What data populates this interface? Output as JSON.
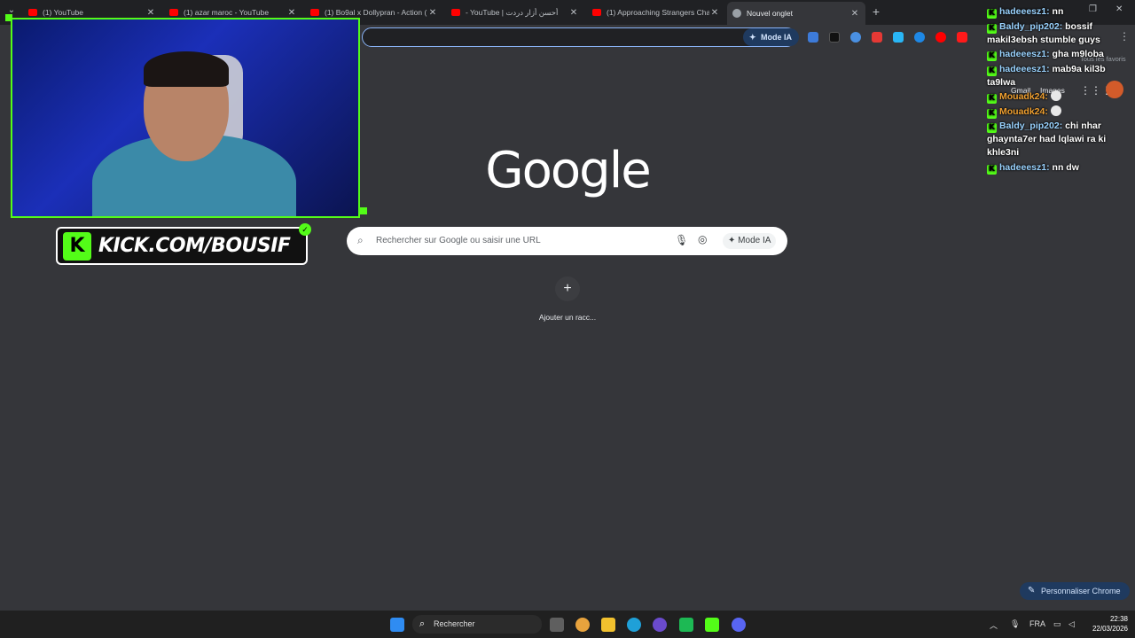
{
  "browser": {
    "tabs": [
      {
        "title": "(1) YouTube",
        "favicon": "youtube-icon"
      },
      {
        "title": "(1) azar maroc - YouTube",
        "favicon": "youtube-icon"
      },
      {
        "title": "(1) Bo9al x Dollypran - Action (",
        "favicon": "youtube-icon"
      },
      {
        "title": "- YouTube | أحسن أزار دردت",
        "favicon": "youtube-icon"
      },
      {
        "title": "(1) Approaching Strangers Char",
        "favicon": "youtube-icon"
      },
      {
        "title": "Nouvel onglet",
        "favicon": "chrome-icon",
        "active": true
      }
    ],
    "new_tab_label": "+",
    "mode_ia_top": "Mode IA",
    "favorites_label": "Tous les favoris"
  },
  "stream": {
    "kick_url": "KICK.COM/BOUSIF",
    "kick_logo_letter": "K",
    "accent_color": "#53fc18"
  },
  "ntp": {
    "logo": "Google",
    "search_placeholder": "Rechercher sur Google ou saisir une URL",
    "mode_ia_label": "Mode IA",
    "shortcut_add_symbol": "+",
    "shortcut_label": "Ajouter un racc...",
    "links": {
      "gmail": "Gmail",
      "images": "Images"
    },
    "customize_label": "Personnaliser Chrome"
  },
  "chat": {
    "messages": [
      {
        "user": "hadeeesz1:",
        "text": "nn",
        "color": "blue"
      },
      {
        "user": "Baldy_pip202:",
        "text": "bossif makil3ebsh stumble guys",
        "color": "blue"
      },
      {
        "user": "hadeeesz1:",
        "text": "gha m9loba",
        "color": "blue"
      },
      {
        "user": "hadeeesz1:",
        "text": "mab9a kil3b ta9lwa",
        "color": "blue"
      },
      {
        "user": "Mouadk24:",
        "text": "",
        "color": "orange",
        "emote": true
      },
      {
        "user": "Mouadk24:",
        "text": "",
        "color": "orange",
        "emote": true
      },
      {
        "user": "Baldy_pip202:",
        "text": "chi nhar ghaynta7er had lqlawi ra ki khle3ni",
        "color": "blue"
      },
      {
        "user": "hadeeesz1:",
        "text": "nn dw",
        "color": "blue"
      }
    ]
  },
  "taskbar": {
    "search_label": "Rechercher",
    "language": "FRA",
    "time": "22:38",
    "date": "22/03/2026"
  }
}
